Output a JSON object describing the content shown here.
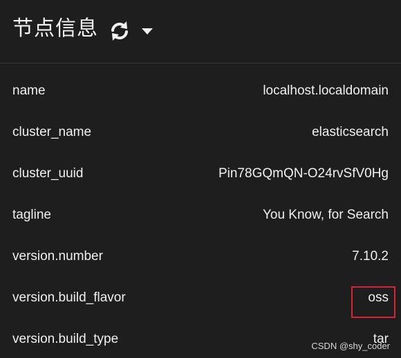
{
  "header": {
    "title": "节点信息",
    "refresh_icon": "refresh-icon",
    "dropdown_icon": "caret-down-icon"
  },
  "rows": [
    {
      "key": "name",
      "value": "localhost.localdomain"
    },
    {
      "key": "cluster_name",
      "value": "elasticsearch"
    },
    {
      "key": "cluster_uuid",
      "value": "Pin78GQmQN-O24rvSfV0Hg"
    },
    {
      "key": "tagline",
      "value": "You Know, for Search"
    },
    {
      "key": "version.number",
      "value": "7.10.2"
    },
    {
      "key": "version.build_flavor",
      "value": "oss"
    },
    {
      "key": "version.build_type",
      "value": "tar"
    }
  ],
  "highlight_color": "#d9232d",
  "background_color": "#1e1e1e",
  "watermark": "CSDN @shy_coder"
}
